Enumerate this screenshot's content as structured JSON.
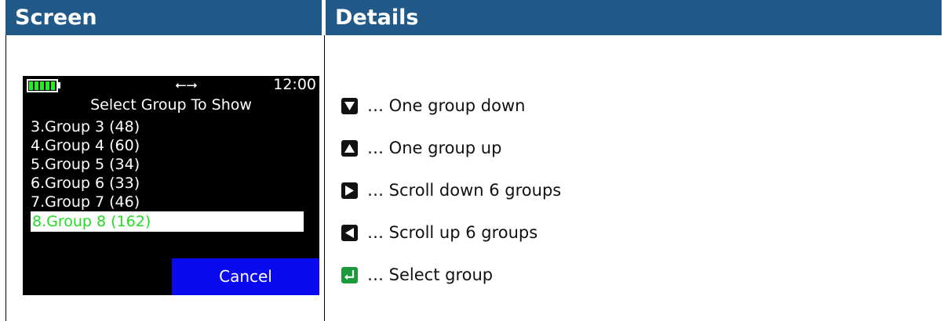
{
  "headers": {
    "screen": "Screen",
    "details": "Details"
  },
  "device": {
    "time": "12:00",
    "usb_icon": "usb-icon",
    "battery_color": "#22ee22",
    "title": "Select Group To Show",
    "groups": [
      "3.Group 3 (48)",
      "4.Group 4 (60)",
      "5.Group 5 (34)",
      "6.Group 6 (33)",
      "7.Group 7 (46)",
      "8.Group 8 (162)"
    ],
    "selected_index": 5,
    "cancel_label": "Cancel"
  },
  "details": [
    {
      "icon": "arrow-down-key-icon",
      "text": "… One group down"
    },
    {
      "icon": "arrow-up-key-icon",
      "text": "… One group up"
    },
    {
      "icon": "arrow-right-key-icon",
      "text": "… Scroll down 6 groups"
    },
    {
      "icon": "arrow-left-key-icon",
      "text": "… Scroll up 6 groups"
    },
    {
      "icon": "enter-key-icon",
      "text": "… Select group"
    }
  ]
}
